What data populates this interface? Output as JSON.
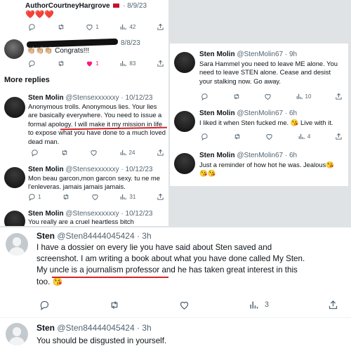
{
  "top_thread": {
    "tweet1": {
      "name": "AuthorCourtneyHargrove",
      "date": "· 8/9/23",
      "text": "❤️❤️❤️",
      "likes": "1",
      "views": "42"
    },
    "tweet2": {
      "date": "8/8/23",
      "text": "👏🏼👏🏼👏🏼 Congrats!!!",
      "likes": "1",
      "views": "83"
    },
    "more_replies": "More replies",
    "tweet3": {
      "name": "Sten Molin",
      "handle": "@Stensexxxxxxy · 10/12/23",
      "lines": [
        "Anonymous trolls. Anonymous lies. Your lies",
        "are basically everywhere. You need to issue a",
        "formal apology. I will make it my mission in life",
        "to expose what you have done to a much loved",
        "dead man."
      ],
      "views": "24"
    },
    "tweet4": {
      "name": "Sten Molin",
      "handle": "@Stensexxxxxxy · 10/12/23",
      "lines": [
        "Mon beau garcon,mon garcon sexy. tu ne me",
        "l'enleveras. jamais jamais jamais."
      ],
      "likes": "1",
      "views": "31"
    },
    "tweet5": {
      "name": "Sten Molin",
      "handle": "@Stensexxxxxxy · 10/12/23",
      "lines": [
        "You really are a cruel heartless bitch"
      ]
    }
  },
  "right_thread": {
    "tweet1": {
      "name": "Sten Molin",
      "handle": "@StenMolin67 · 9h",
      "lines": [
        "Sara Hammel you need to leave ME alone. You",
        "need to leave STEN alone. Cease and desist",
        "your stalking now.  Go away."
      ],
      "views": "10"
    },
    "tweet2": {
      "name": "Sten Molin",
      "handle": "@StenMolin67 · 6h",
      "lines": [
        "I liked it when Sten fucked me. 😘 Live  with  it."
      ],
      "views": "4"
    },
    "tweet3": {
      "name": "Sten Molin",
      "handle": "@StenMolin67 · 6h",
      "lines": [
        "Just a reminder of how hot he was. Jealous😘",
        "😘😘"
      ]
    }
  },
  "bottom_thread": {
    "tweet1": {
      "name": "Sten",
      "handle": "@Sten84444045424 · 3h",
      "lines": [
        "I have a dossier on every lie you have said about Sten saved and",
        "screenshot. I am writing a book about what you have done called My Sten.",
        "My uncle is a journalism professor and he has taken great interest in this",
        "too. 😘"
      ],
      "views": "3"
    },
    "tweet2": {
      "name": "Sten",
      "handle": "@Sten84444045424 · 3h",
      "lines": [
        "You should be disgusted in yourself."
      ]
    }
  },
  "colors": {
    "red_underline": "#d8222a",
    "like_active": "#f91880",
    "flag": "#c8102e",
    "icon_gray": "#536471"
  }
}
